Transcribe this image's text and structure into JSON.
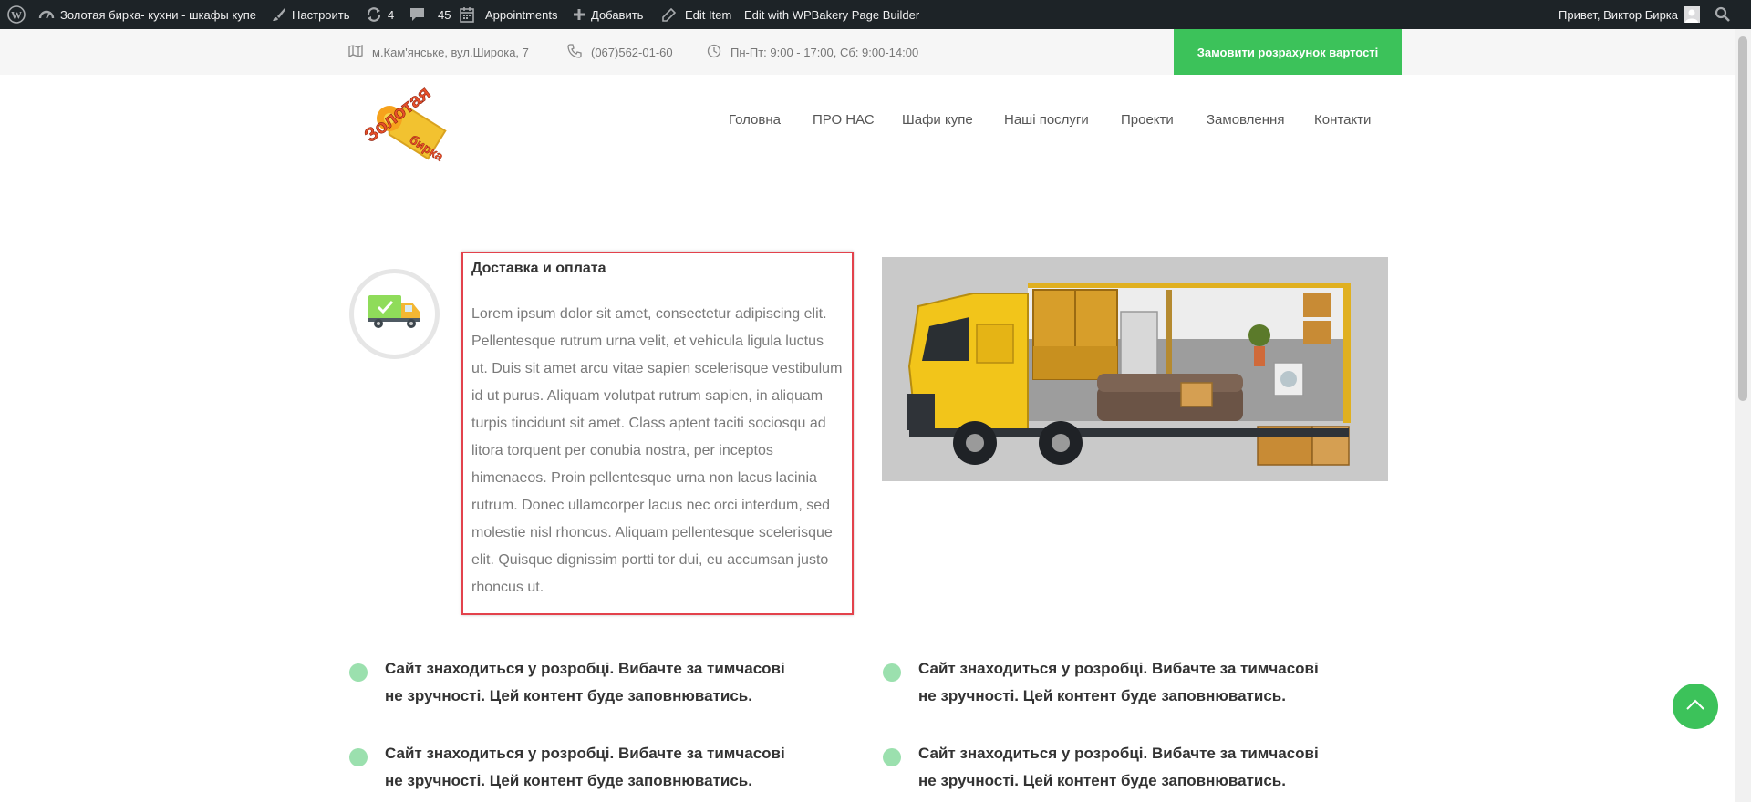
{
  "admin_bar": {
    "site_name": "Золотая бирка- кухни - шкафы купе",
    "customize": "Настроить",
    "updates_count": "4",
    "comments_count": "45",
    "appointments": "Appointments",
    "add_new": "Добавить",
    "edit_item": "Edit Item",
    "wpbakery": "Edit with WPBakery Page Builder",
    "greeting": "Привет, Виктор Бирка"
  },
  "topbar": {
    "address": "м.Кам'янське, вул.Широка, 7",
    "phone": "(067)562-01-60",
    "hours": "Пн-Пт: 9:00 - 17:00, Сб: 9:00-14:00",
    "cta_label": "Замовити розрахунок вартості"
  },
  "logo": {
    "text_line1": "Золотая",
    "text_line2": "бирка"
  },
  "nav": {
    "items": [
      "Головна",
      "ПРО НАС",
      "Шафи купе",
      "Наші послуги",
      "Проекти",
      "Замовлення",
      "Контакти"
    ]
  },
  "feature": {
    "title": "Доставка и оплата",
    "body": "Lorem ipsum dolor sit amet, consectetur adipiscing elit. Pellentesque rutrum urna velit, et vehicula ligula luctus ut. Duis sit amet arcu vitae sapien scelerisque vestibulum id ut purus. Aliquam volutpat rutrum sapien, in aliquam turpis tincidunt sit amet. Class aptent taciti sociosqu ad litora torquent per conubia nostra, per inceptos himenaeos. Proin pellentesque urna non lacus lacinia rutrum. Donec ullamcorper lacus nec orci interdum, sed molestie nisl rhoncus. Aliquam pellentesque scelerisque elit. Quisque dignissim portti tor dui, eu accumsan justo rhoncus ut."
  },
  "bullets": [
    "Сайт знаходиться у розробці. Вибачте за тимчасові не зручності. Цей контент буде заповнюватись.",
    "Сайт знаходиться у розробці. Вибачте за тимчасові не зручності. Цей контент буде заповнюватись.",
    "Сайт знаходиться у розробці. Вибачте за тимчасові не зручності. Цей контент буде заповнюватись.",
    "Сайт знаходиться у розробці. Вибачте за тимчасові не зручності. Цей контент буде заповнюватись."
  ],
  "colors": {
    "accent_green": "#3cc25a",
    "bullet_green": "#9be0ae",
    "highlight_red": "#e3424c",
    "admin_bar_bg": "#1d2327"
  },
  "icons": {
    "wp": "wordpress-icon",
    "dashboard": "dashboard-icon",
    "customize": "brush-icon",
    "updates": "refresh-icon",
    "comments": "comment-icon",
    "calendar": "calendar-icon",
    "add": "plus-icon",
    "edit": "pencil-icon",
    "search": "search-icon",
    "map": "map-icon",
    "phone": "phone-icon",
    "clock": "clock-icon",
    "truck": "delivery-truck-icon",
    "to_top": "chevron-up-icon"
  }
}
